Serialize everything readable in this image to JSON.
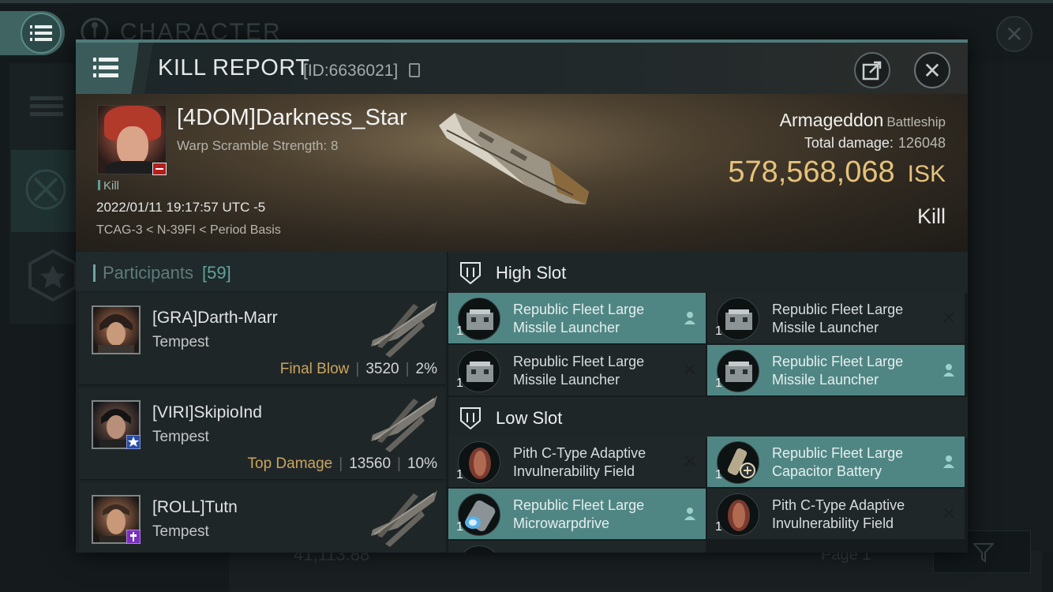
{
  "background": {
    "title": "CHARACTER",
    "wallet": "41,113.88",
    "page_label": "Page 1"
  },
  "header": {
    "title": "KILL REPORT",
    "id_label": "[ID:6636021]"
  },
  "victim": {
    "name": "[4DOM]Darkness_Star",
    "warp_scramble": "Warp Scramble Strength: 8",
    "kill_tag": "Kill",
    "time": "2022/01/11 19:17:57 UTC -5",
    "location": "TCAG-3 < N-39FI < Period Basis"
  },
  "ship": {
    "name": "Armageddon",
    "class": "Battleship",
    "total_damage_label": "Total damage:",
    "total_damage": "126048",
    "isk_value": "578,568,068",
    "isk_unit": "ISK",
    "result": "Kill"
  },
  "participants": {
    "label": "Participants",
    "count": "[59]",
    "rows": [
      {
        "name": "[GRA]Darth-Marr",
        "ship": "Tempest",
        "tag": "Final Blow",
        "damage": "3520",
        "percent": "2%"
      },
      {
        "name": "[VIRI]SkipioInd",
        "ship": "Tempest",
        "tag": "Top Damage",
        "damage": "13560",
        "percent": "10%"
      },
      {
        "name": "[ROLL]Tutn",
        "ship": "Tempest"
      }
    ]
  },
  "fitting": {
    "high_slot": {
      "title": "High Slot",
      "modules": [
        {
          "name": "Republic Fleet Large Missile Launcher",
          "qty": "1",
          "highlighted": true,
          "status": "pilot"
        },
        {
          "name": "Republic Fleet Large Missile Launcher",
          "qty": "1",
          "highlighted": false,
          "status": "destroyed"
        },
        {
          "name": "Republic Fleet Large Missile Launcher",
          "qty": "1",
          "highlighted": false,
          "status": "destroyed"
        },
        {
          "name": "Republic Fleet Large Missile Launcher",
          "qty": "1",
          "highlighted": true,
          "status": "pilot"
        }
      ]
    },
    "low_slot": {
      "title": "Low Slot",
      "modules": [
        {
          "name": "Pith C-Type Adaptive Invulnerability Field",
          "qty": "1",
          "highlighted": false,
          "status": "destroyed"
        },
        {
          "name": "Republic Fleet Large Capacitor Battery",
          "qty": "1",
          "highlighted": true,
          "status": "pilot"
        },
        {
          "name": "Republic Fleet Large Microwarpdrive",
          "qty": "1",
          "highlighted": true,
          "status": "pilot"
        },
        {
          "name": "Pith C-Type Adaptive Invulnerability Field",
          "qty": "1",
          "highlighted": false,
          "status": "destroyed"
        }
      ]
    }
  },
  "colors": {
    "accent": "#4f8684",
    "isk_gold": "#e6c27a",
    "kill_badge": "#b61d1d"
  }
}
